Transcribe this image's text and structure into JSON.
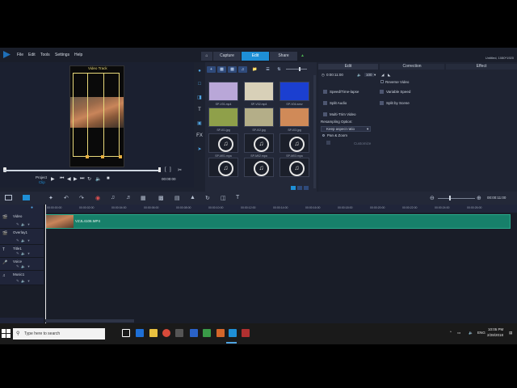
{
  "menubar": {
    "items": [
      "File",
      "Edit",
      "Tools",
      "Settings",
      "Help"
    ],
    "tabs": [
      "Capture",
      "Edit",
      "Share"
    ],
    "active_tab": "Edit",
    "project_name": "Untitled, 1080*1920"
  },
  "player": {
    "overlay_title": "Video Track",
    "project_label": "Project",
    "clip_label": "Clip",
    "timecode": "00:00:00"
  },
  "library": {
    "thumbnails": [
      {
        "label": "SP-V01.mp4",
        "kind": "video",
        "color": "#b9a7d8"
      },
      {
        "label": "SP-V02.mp4",
        "kind": "video",
        "color": "#d8d0b8"
      },
      {
        "label": "SP-V04.wmv",
        "kind": "video",
        "color": "#1b3fd0"
      },
      {
        "label": "SP-I01.jpg",
        "kind": "image",
        "color": "#8fa04a"
      },
      {
        "label": "SP-I02.jpg",
        "kind": "image",
        "color": "#b4ae88"
      },
      {
        "label": "SP-I03.jpg",
        "kind": "image",
        "color": "#d08a58"
      },
      {
        "label": "SP-M01.mpa",
        "kind": "audio",
        "color": "#1b1f2a"
      },
      {
        "label": "SP-M02.mpa",
        "kind": "audio",
        "color": "#1b1f2a"
      },
      {
        "label": "SP-M03.mpa",
        "kind": "audio",
        "color": "#1b1f2a"
      },
      {
        "label": "SP-M04.mpa",
        "kind": "audio",
        "color": "#1b1f2a"
      },
      {
        "label": "SP-M05.mpa",
        "kind": "audio",
        "color": "#1b1f2a"
      },
      {
        "label": "SP-M06.mpa",
        "kind": "audio",
        "color": "#1b1f2a"
      }
    ]
  },
  "options": {
    "tabs": [
      "Edit",
      "Correction",
      "Effect"
    ],
    "duration": "0:00:11:00",
    "volume": "100",
    "reverse_video": "Reverse Video",
    "speed_time_lapse": "Speed/Time-lapse",
    "variable_speed": "Variable Speed",
    "split_audio": "Split Audio",
    "split_by_scene": "Split by Scene",
    "multi_trim": "Multi-Trim Video",
    "resampling_option": "Resampling Option:",
    "resampling_value": "Keep aspect ratio",
    "pan_zoom": "Pan & Zoom",
    "customize": "Customize"
  },
  "timeline": {
    "timecode": "00:00:11:00",
    "ruler_labels": [
      "00:00:00:00",
      "00:00:02:00",
      "00:00:04:00",
      "00:00:06:00",
      "00:00:08:00",
      "00:00:10:00",
      "00:00:12:00",
      "00:00:14:00",
      "00:00:16:00",
      "00:00:18:00",
      "00:00:20:00",
      "00:00:22:00",
      "00:00:24:00",
      "00:00:26:00"
    ],
    "tracks": [
      "Video",
      "Overlay1",
      "Title1",
      "Voice",
      "Music1"
    ],
    "clip_name": "VZJL4106.MP4"
  },
  "taskbar": {
    "search_placeholder": "Type here to search",
    "language": "ENG",
    "time": "10:05 PM",
    "date": "2/28/2018"
  },
  "colors": {
    "accent": "#1e8fd6",
    "clip": "#17806a"
  }
}
